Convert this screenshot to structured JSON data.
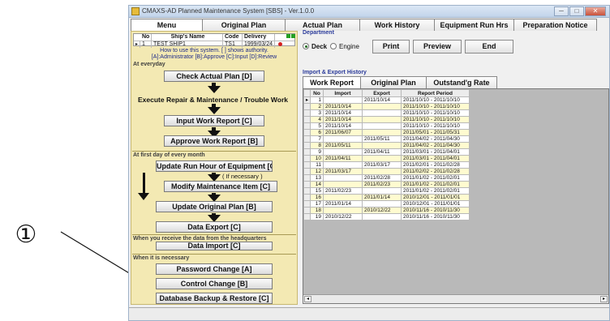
{
  "callout": {
    "marker": "①"
  },
  "window": {
    "title": "CMAXS-AD Planned Maintenance System [SBS] - Ver.1.0.0",
    "controls": [
      "─",
      "□",
      "✕"
    ]
  },
  "tabs": [
    "Menu",
    "Original Plan",
    "Actual Plan",
    "Work History",
    "Equipment Run Hrs",
    "Preparation Notice"
  ],
  "ship_table": {
    "headers": [
      "No",
      "Ship's Name",
      "Code",
      "Delivery"
    ],
    "row": {
      "no": "1",
      "name": "TEST SHIP1",
      "code": "TS1",
      "delivery": "1999/03/24"
    }
  },
  "help": {
    "line1": "How to use this system. [ ] shows authority.",
    "line2": "[A]:Administrator [B]:Approve [C]:Input [D]:Review"
  },
  "sections": {
    "everyday": "At everyday",
    "monthly": "At first day of every month",
    "hq": "When you receive the data from the headquarters",
    "necessary": "When it is necessary"
  },
  "menu": {
    "check_actual_plan": "Check Actual Plan [D]",
    "execute_text": "Execute Repair & Maintenance / Trouble Work",
    "input_work_report": "Input Work Report [C]",
    "approve_work_report": "Approve Work Report [B]",
    "update_run_hour": "Update Run Hour of Equipment [C]",
    "if_necessary": "( If necessary )",
    "modify_maintenance_item": "Modify Maintenance Item [C]",
    "update_original_plan": "Update Original Plan [B]",
    "data_export": "Data Export [C]",
    "data_import": "Data Import [C]",
    "password_change": "Password Change [A]",
    "control_change": "Control Change [B]",
    "database_backup": "Database Backup & Restore [C]"
  },
  "department": {
    "label": "Department",
    "deck": "Deck",
    "engine": "Engine",
    "selected": "Deck"
  },
  "toolbar": {
    "print": "Print",
    "preview": "Preview",
    "end": "End"
  },
  "history": {
    "title": "Import & Export History",
    "tabs": [
      "Work Report",
      "Original Plan",
      "Outstand'g Rate"
    ],
    "columns": [
      "No",
      "Import",
      "Export",
      "Report Period"
    ],
    "rows": [
      {
        "no": "1",
        "import": "",
        "export": "2011/10/14",
        "period": "2011/10/10 - 2011/10/10"
      },
      {
        "no": "2",
        "import": "2011/10/14",
        "export": "",
        "period": "2011/10/10 - 2011/10/10"
      },
      {
        "no": "3",
        "import": "2011/10/14",
        "export": "",
        "period": "2011/10/10 - 2011/10/10"
      },
      {
        "no": "4",
        "import": "2011/10/14",
        "export": "",
        "period": "2011/10/10 - 2011/10/10"
      },
      {
        "no": "5",
        "import": "2011/10/14",
        "export": "",
        "period": "2011/10/10 - 2011/10/10"
      },
      {
        "no": "6",
        "import": "2011/06/07",
        "export": "",
        "period": "2011/05/01 - 2011/05/31"
      },
      {
        "no": "7",
        "import": "",
        "export": "2011/05/11",
        "period": "2011/04/02 - 2011/04/30"
      },
      {
        "no": "8",
        "import": "2011/05/11",
        "export": "",
        "period": "2011/04/02 - 2011/04/30"
      },
      {
        "no": "9",
        "import": "",
        "export": "2011/04/11",
        "period": "2011/03/01 - 2011/04/01"
      },
      {
        "no": "10",
        "import": "2011/04/11",
        "export": "",
        "period": "2011/03/01 - 2011/04/01"
      },
      {
        "no": "11",
        "import": "",
        "export": "2011/03/17",
        "period": "2011/02/01 - 2011/02/28"
      },
      {
        "no": "12",
        "import": "2011/03/17",
        "export": "",
        "period": "2011/02/02 - 2011/02/28"
      },
      {
        "no": "13",
        "import": "",
        "export": "2011/02/28",
        "period": "2011/01/02 - 2011/02/01"
      },
      {
        "no": "14",
        "import": "",
        "export": "2011/02/23",
        "period": "2011/01/02 - 2011/02/01"
      },
      {
        "no": "15",
        "import": "2011/02/23",
        "export": "",
        "period": "2011/01/02 - 2011/02/01"
      },
      {
        "no": "16",
        "import": "",
        "export": "2011/01/14",
        "period": "2010/12/01 - 2011/01/01"
      },
      {
        "no": "17",
        "import": "2011/01/14",
        "export": "",
        "period": "2010/12/01 - 2011/01/01"
      },
      {
        "no": "18",
        "import": "",
        "export": "2010/12/22",
        "period": "2010/11/16 - 2010/11/30"
      },
      {
        "no": "19",
        "import": "2010/12/22",
        "export": "",
        "period": "2010/11/16 - 2010/11/30"
      }
    ]
  },
  "colors": {
    "menu_panel": "#f3e9b3",
    "row_highlight": "#fffbd0",
    "label_blue": "#2a3a9a"
  }
}
